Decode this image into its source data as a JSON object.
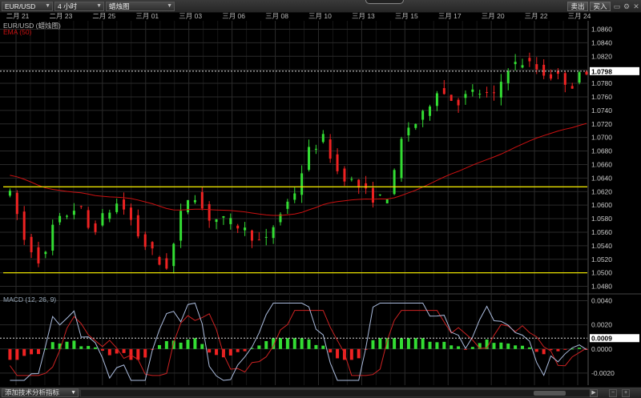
{
  "toolbar": {
    "symbol": "EUR/USD",
    "timeframe": "4 小时",
    "chart_style": "蜡烛图",
    "sell_label": "卖出",
    "buy_label": "买入"
  },
  "bottom": {
    "add_indicator": "添加技术分析指标"
  },
  "colors": {
    "background": "#000000",
    "grid": "#2a2a2a",
    "bull": "#33dd33",
    "bear": "#ee2222",
    "ema": "#cc1111",
    "support": "#e8e000",
    "macd_line": "#aabbdd",
    "signal_line": "#cc2222"
  },
  "chart_data": [
    {
      "type": "candlestick",
      "title": "EUR/USD (蜡烛图)",
      "series": [
        {
          "name": "EMA (50)"
        }
      ],
      "x_tick_labels": [
        "二月 21",
        "二月 23",
        "二月 25",
        "三月 01",
        "三月 03",
        "三月 06",
        "三月 08",
        "三月 10",
        "三月 13",
        "三月 15",
        "三月 17",
        "三月 20",
        "三月 22",
        "三月 24"
      ],
      "y_tick_labels": [
        "1.0860",
        "1.0840",
        "1.0820",
        "1.0800",
        "1.0780",
        "1.0760",
        "1.0740",
        "1.0720",
        "1.0700",
        "1.0680",
        "1.0660",
        "1.0640",
        "1.0620",
        "1.0600",
        "1.0580",
        "1.0560",
        "1.0540",
        "1.0520",
        "1.0500",
        "1.0480"
      ],
      "ylim": [
        1.047,
        1.087
      ],
      "current_price": "1.0798",
      "horizontal_lines": [
        1.0627,
        1.05
      ],
      "grid": true
    },
    {
      "type": "bar",
      "title": "MACD (12, 26, 9)",
      "y_tick_labels": [
        "0.0040",
        "0.0020",
        "0.0000",
        "-0.0020"
      ],
      "ylim": [
        -0.003,
        0.0045
      ],
      "current_value": "0.0009",
      "grid": true
    }
  ]
}
